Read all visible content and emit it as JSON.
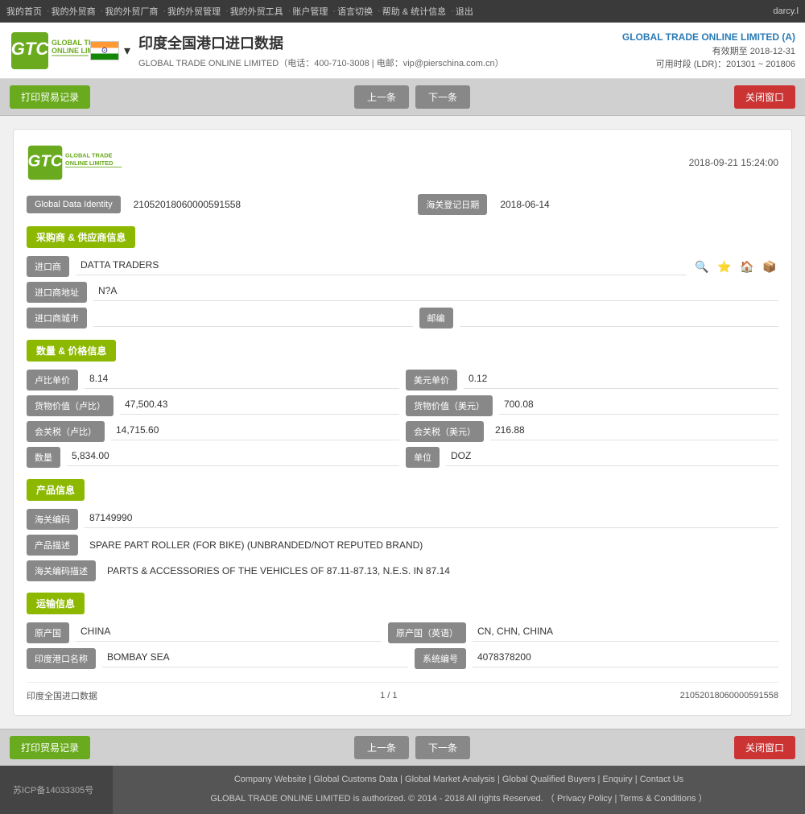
{
  "topnav": {
    "items": [
      "我的首页",
      "我的外贸商",
      "我的外贸厂商",
      "我的外贸管理",
      "我的外贸工具",
      "账户管理",
      "语言切换",
      "帮助 & 统计信息",
      "退出"
    ],
    "user": "darcy.l"
  },
  "header": {
    "title": "印度全国港口进口数据",
    "company_line": "GLOBAL TRADE ONLINE LIMITED（电话：400-710-3008 | 电邮：vip@pierschina.com.cn）",
    "company_name": "GLOBAL TRADE ONLINE LIMITED (A)",
    "validity": "有效期至 2018-12-31",
    "ldr": "可用时段 (LDR)：201301 ~ 201806"
  },
  "toolbar": {
    "print_label": "打印贸易记录",
    "prev_label": "上一条",
    "next_label": "下一条",
    "close_label": "关闭窗口"
  },
  "record": {
    "datetime": "2018-09-21 15:24:00",
    "global_data_identity_label": "Global Data Identity",
    "global_data_identity_value": "21052018060000591558",
    "customs_date_label": "海关登记日期",
    "customs_date_value": "2018-06-14",
    "section_buyer_supplier": "采购商 & 供应商信息",
    "importer_label": "进口商",
    "importer_value": "DATTA TRADERS",
    "importer_address_label": "进口商地址",
    "importer_address_value": "N?A",
    "importer_city_label": "进口商城市",
    "importer_city_value": "",
    "postal_code_label": "邮编",
    "postal_code_value": "",
    "section_price": "数量 & 价格信息",
    "unit_price_inr_label": "卢比单价",
    "unit_price_inr_value": "8.14",
    "unit_price_usd_label": "美元单价",
    "unit_price_usd_value": "0.12",
    "cargo_value_inr_label": "货物价值（卢比）",
    "cargo_value_inr_value": "47,500.43",
    "cargo_value_usd_label": "货物价值（美元）",
    "cargo_value_usd_value": "700.08",
    "customs_duty_inr_label": "会关税（卢比）",
    "customs_duty_inr_value": "14,715.60",
    "customs_duty_usd_label": "会关税（美元）",
    "customs_duty_usd_value": "216.88",
    "quantity_label": "数量",
    "quantity_value": "5,834.00",
    "unit_label": "单位",
    "unit_value": "DOZ",
    "section_product": "产品信息",
    "hs_code_label": "海关编码",
    "hs_code_value": "87149990",
    "product_desc_label": "产品描述",
    "product_desc_value": "SPARE PART ROLLER (FOR BIKE) (UNBRANDED/NOT REPUTED BRAND)",
    "hs_code_desc_label": "海关编码描述",
    "hs_code_desc_value": "PARTS & ACCESSORIES OF THE VEHICLES OF 87.11-87.13, N.E.S. IN 87.14",
    "section_transport": "运输信息",
    "origin_country_label": "原产国",
    "origin_country_value": "CHINA",
    "origin_country_en_label": "原产国（英语）",
    "origin_country_en_value": "CN, CHN, CHINA",
    "india_port_label": "印度港口名称",
    "india_port_value": "BOMBAY SEA",
    "system_code_label": "系统编号",
    "system_code_value": "4078378200",
    "footer_source": "印度全国进口数据",
    "footer_page": "1 / 1",
    "footer_id": "21052018060000591558"
  },
  "page_footer": {
    "links": [
      "Company Website",
      "Global Customs Data",
      "Global Market Analysis",
      "Global Qualified Buyers",
      "Enquiry",
      "Contact Us"
    ],
    "copyright": "GLOBAL TRADE ONLINE LIMITED is authorized. © 2014 - 2018 All rights Reserved.  （",
    "privacy": "Privacy Policy",
    "pipe": "|",
    "terms": "Terms & Conditions",
    "end": "）",
    "icp": "苏ICP备14033305号"
  }
}
